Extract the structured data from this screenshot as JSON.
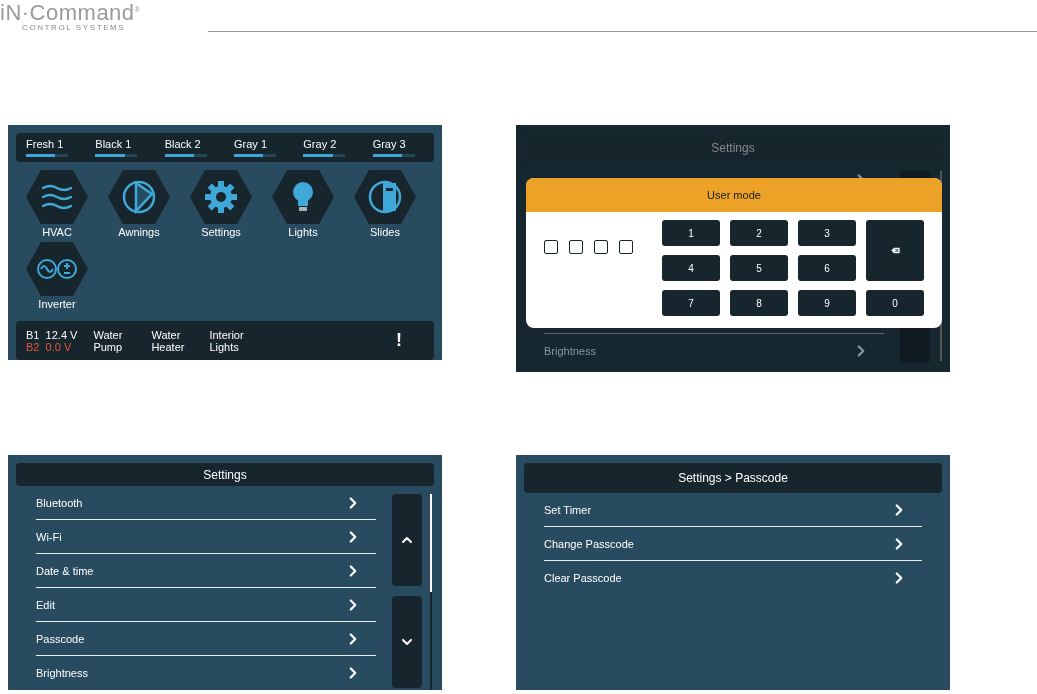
{
  "header": {
    "logo_text": "iN·Command",
    "logo_mark": "®",
    "logo_subtitle": "CONTROL SYSTEMS"
  },
  "home_screen": {
    "tanks": [
      {
        "name": "Fresh 1",
        "level": 0.7
      },
      {
        "name": "Black 1",
        "level": 0.7
      },
      {
        "name": "Black 2",
        "level": 0.7
      },
      {
        "name": "Gray 1",
        "level": 0.7
      },
      {
        "name": "Gray 2",
        "level": 0.7
      },
      {
        "name": "Gray 3",
        "level": 0.7
      }
    ],
    "apps": [
      {
        "label": "HVAC",
        "kind": "hvac"
      },
      {
        "label": "Awnings",
        "kind": "awnings"
      },
      {
        "label": "Settings",
        "kind": "settings"
      },
      {
        "label": "Lights",
        "kind": "lights"
      },
      {
        "label": "Slides",
        "kind": "slides"
      },
      {
        "label": "Inverter",
        "kind": "inverter"
      }
    ],
    "batteries": [
      {
        "name": "B1",
        "reading": "12.4 V",
        "warning": false
      },
      {
        "name": "B2",
        "reading": "0.0 V",
        "warning": true
      }
    ],
    "switches": [
      "Water Pump",
      "Water Heater",
      "Interior Lights"
    ],
    "alert": "!"
  },
  "user_mode_screen": {
    "title": "Settings",
    "rows": [
      "Brightness"
    ],
    "dialog": {
      "title": "User mode",
      "pin_boxes": [
        {
          "filled": false
        },
        {
          "filled": false
        },
        {
          "filled": false
        },
        {
          "filled": false
        }
      ],
      "keys": [
        {
          "kind": "digit",
          "label": "1"
        },
        {
          "kind": "digit",
          "label": "2"
        },
        {
          "kind": "digit",
          "label": "3"
        },
        {
          "kind": "backspace"
        },
        {
          "kind": "digit",
          "label": "4"
        },
        {
          "kind": "digit",
          "label": "5"
        },
        {
          "kind": "digit",
          "label": "6"
        },
        {
          "kind": "digit",
          "label": "7"
        },
        {
          "kind": "digit",
          "label": "8"
        },
        {
          "kind": "digit",
          "label": "9"
        },
        {
          "kind": "digit",
          "label": "0"
        }
      ]
    }
  },
  "settings_screen": {
    "title": "Settings",
    "rows": [
      "Bluetooth",
      "Wi-Fi",
      "Date & time",
      "Edit",
      "Passcode",
      "Brightness"
    ]
  },
  "passcode_screen": {
    "title": "Settings > Passcode",
    "rows": [
      "Set Timer",
      "Change Passcode",
      "Clear Passcode"
    ]
  }
}
